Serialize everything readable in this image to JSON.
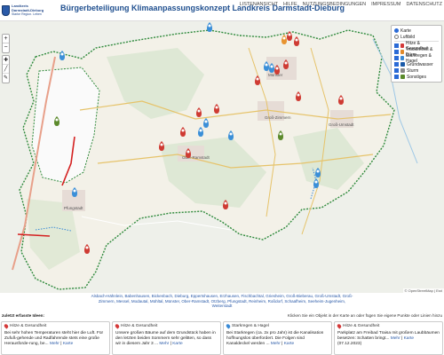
{
  "header": {
    "logo_lines": [
      "Landkreis",
      "Darmstadt-Dieburg",
      "Starke Region. Leben"
    ],
    "title": "Bürgerbeteiligung Klimaanpassungskonzept Landkreis Darmstadt-Dieburg",
    "nav": [
      "LISTENANSICHT",
      "HILFE",
      "NUTZUNGSBEDINGUNGEN",
      "IMPRESSUM",
      "DATENSCHUTZ"
    ]
  },
  "map": {
    "zoom_in": "+",
    "zoom_out": "−",
    "layers": {
      "base": [
        {
          "label": "Karte",
          "selected": true
        },
        {
          "label": "Luftbild",
          "selected": false
        }
      ],
      "overlays": [
        {
          "label": "Hitze & Gesundheit",
          "color": "#d43a3a",
          "checked": true
        },
        {
          "label": "Trockenheit & Dürre",
          "color": "#e08a2b",
          "checked": true
        },
        {
          "label": "Starkregen & Hagel",
          "color": "#3a8ad6",
          "checked": true
        },
        {
          "label": "Grundwasser",
          "color": "#1a5aa8",
          "checked": true
        },
        {
          "label": "Sturm",
          "color": "#8a8a8a",
          "checked": true
        },
        {
          "label": "Sonstiges",
          "color": "#5a8a2b",
          "checked": true
        }
      ]
    },
    "place_labels": [
      "Groß-Zimmern",
      "Groß-Umstadt",
      "Ober-Ramstadt",
      "Pfungstadt",
      "Münster",
      "Dieburg",
      "Babenhausen"
    ],
    "attribution": "© OpenStreetMap | Esri"
  },
  "places_text": "Alsbach-Hähnlein, Babenhausen, Bickenbach, Dieburg, Eppertshausen, Erzhausen, Fischbachtal, Griesheim, Groß-Bieberau, Groß-Umstadt, Groß-Zimmern, Messel, Modautal, Mühltal, Münster, Ober-Ramstadt, Otzberg, Pfungstadt, Reinheim, Roßdorf, Schaafheim, Seeheim-Jugenheim, Weiterstadt",
  "ideas": {
    "heading": "zuletzt erfasste Ideen:",
    "hint": "Klicken Sie ein Objekt in der Karte an oder fügen Sie eigene Punkte oder Linien hinzu"
  },
  "cards": [
    {
      "category": "Hitze & Gesundheit",
      "color": "#d43a3a",
      "text": "Bei sehr hohen Temperaturen steht hier die Luft. Für Zufuß-gehende und Radfahrende stets eine große Herausforde-rung, be...",
      "more": "Mehr",
      "more2": "Karte"
    },
    {
      "category": "Hitze & Gesundheit",
      "color": "#d43a3a",
      "text": "Unsere großen Bäume auf dem Grundstück haben in den letzten beiden Sommern sehr gelitten, so dass wir in diesem Jahr 3 ...",
      "more": "Mehr",
      "more2": "Karte"
    },
    {
      "category": "Starkregen & Hagel",
      "color": "#3a8ad6",
      "text": "Bei Starkregen (ca. 2x pro Jahr) ist die Kanalisation hoffnungslos überfordert. Die Folgen sind Kanaldeckel werden ...",
      "more": "Mehr",
      "more2": "Karte"
    },
    {
      "category": "Hitze & Gesundheit",
      "color": "#d43a3a",
      "text": "Parkplatz am Freibad Traisa mit großem Laubbäumen besetzen: Schatten bringt...",
      "more": "Mehr",
      "more2": "Karte",
      "date": "(07.12.2023)"
    }
  ],
  "pin_colors": {
    "red": "#cf3b33",
    "blue": "#3b8fd8",
    "green": "#5c8a2c",
    "orange": "#e89430"
  }
}
